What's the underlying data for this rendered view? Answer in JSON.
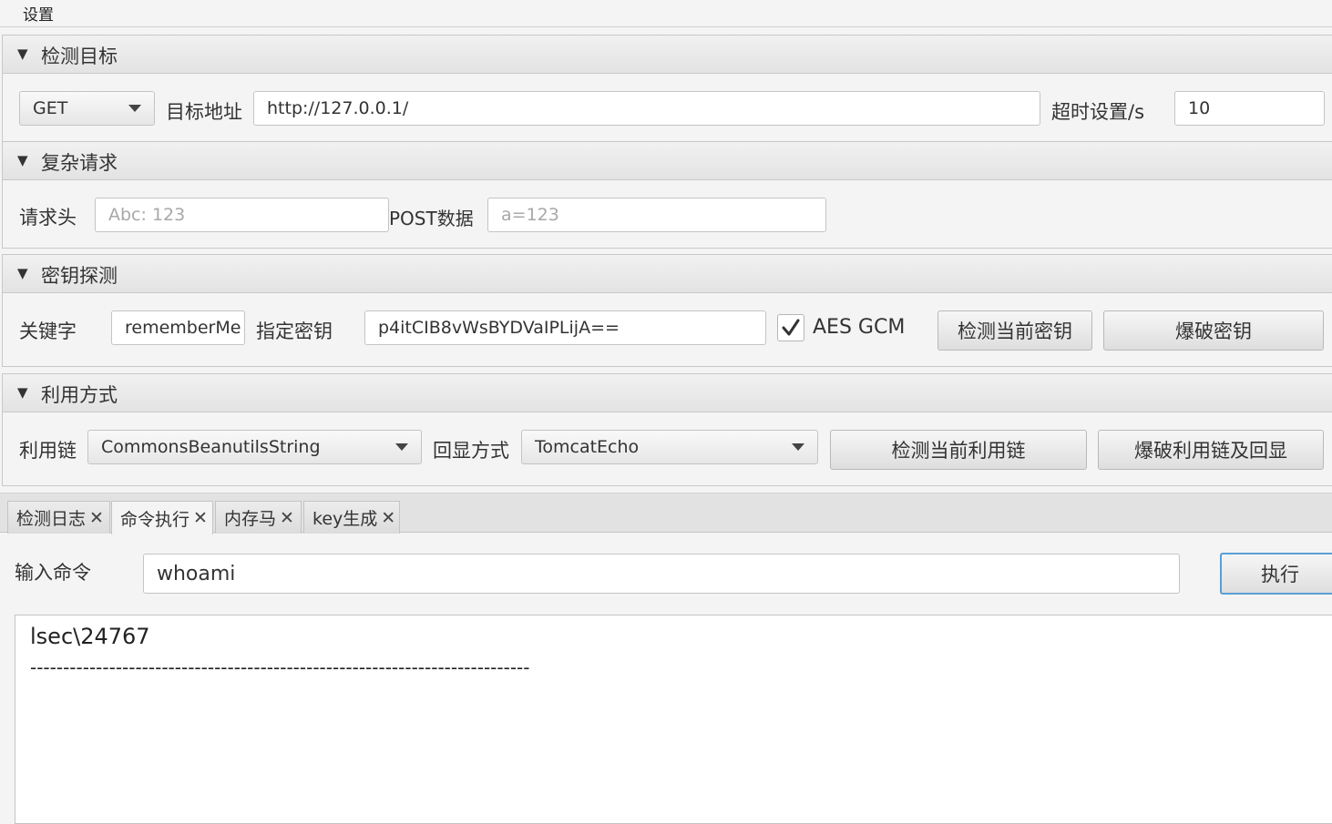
{
  "menu": {
    "settings": "设置"
  },
  "sections": {
    "target": {
      "title": "检测目标",
      "method": "GET",
      "url_label": "目标地址",
      "url_value": "http://127.0.0.1/",
      "timeout_label": "超时设置/s",
      "timeout_value": "10"
    },
    "complex": {
      "title": "复杂请求",
      "headers_label": "请求头",
      "headers_placeholder": "Abc: 123",
      "post_label": "POST数据",
      "post_placeholder": "a=123"
    },
    "key": {
      "title": "密钥探测",
      "keyword_label": "关键字",
      "keyword_value": "rememberMe",
      "key_label": "指定密钥",
      "key_value": "p4itCIB8vWsBYDVaIPLijA==",
      "aes_gcm_label": "AES GCM",
      "aes_gcm_checked": true,
      "check_key_button": "检测当前密钥",
      "brute_key_button": "爆破密钥"
    },
    "exploit": {
      "title": "利用方式",
      "chain_label": "利用链",
      "chain_value": "CommonsBeanutilsString",
      "echo_label": "回显方式",
      "echo_value": "TomcatEcho",
      "check_chain_button": "检测当前利用链",
      "brute_chain_button": "爆破利用链及回显"
    }
  },
  "tabs": [
    {
      "label": "检测日志",
      "active": false
    },
    {
      "label": "命令执行",
      "active": true
    },
    {
      "label": "内存马",
      "active": false
    },
    {
      "label": "key生成",
      "active": false
    }
  ],
  "command": {
    "input_label": "输入命令",
    "input_value": "whoami",
    "execute_button": "执行",
    "output_lines": [
      "lsec\\24767",
      "----------------------------------------------------------------------------"
    ]
  },
  "colors": {
    "primary_border": "#5a9fd4"
  }
}
